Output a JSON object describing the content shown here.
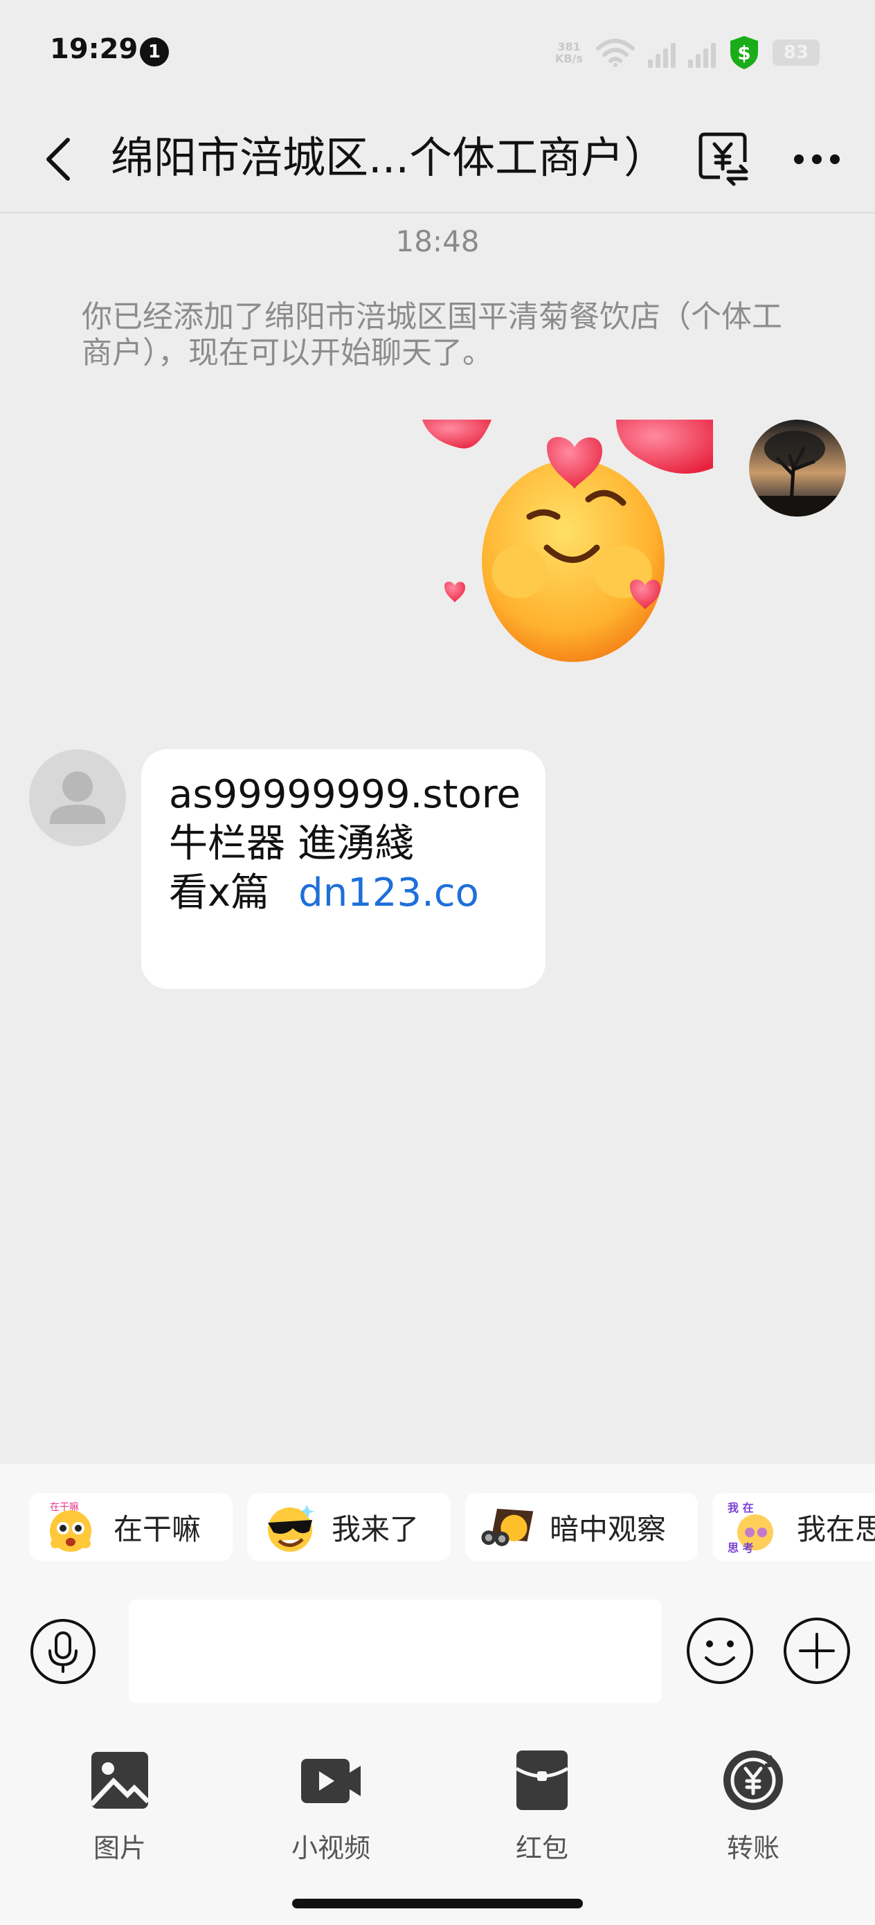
{
  "status_bar": {
    "time": "19:29",
    "notification_count": "1",
    "net_speed_value": "381",
    "net_speed_unit": "KB/s",
    "battery": "83",
    "shield_color": "#1aad19"
  },
  "nav": {
    "title": "绵阳市涪城区...个体工商户）",
    "back_icon": "chevron-left-icon",
    "transfer_icon": "yuan-transfer-icon",
    "more_icon": "more-dots-icon"
  },
  "chat": {
    "timestamp": "18:48",
    "system_message": "你已经添加了绵阳市涪城区国平清菊餐饮店（个体工商户），现在可以开始聊天了。",
    "my_message": {
      "type": "sticker",
      "sticker": "hugging-face-hearts-sticker"
    },
    "their_message": {
      "line1": "as99999999.store",
      "line2": "牛栏器  進湧綫",
      "line3_text": "看x篇",
      "line3_link": "dn123.co"
    }
  },
  "quick_replies": [
    {
      "label": "在干嘛",
      "emoji": "shocked-face-sticker"
    },
    {
      "label": "我来了",
      "emoji": "sunglasses-face-sticker"
    },
    {
      "label": "暗中观察",
      "emoji": "binoculars-sticker"
    },
    {
      "label": "我在思考",
      "emoji": "thinking-sticker"
    }
  ],
  "input": {
    "placeholder": "",
    "voice_icon": "microphone-icon",
    "emoji_icon": "smiley-icon",
    "plus_icon": "plus-circle-icon"
  },
  "tools": [
    {
      "label": "图片",
      "icon": "image-icon"
    },
    {
      "label": "小视频",
      "icon": "video-icon"
    },
    {
      "label": "红包",
      "icon": "red-packet-icon"
    },
    {
      "label": "转账",
      "icon": "transfer-icon"
    }
  ],
  "colors": {
    "background": "#ededed",
    "link": "#1e6fd9",
    "bubble": "#ffffff"
  }
}
